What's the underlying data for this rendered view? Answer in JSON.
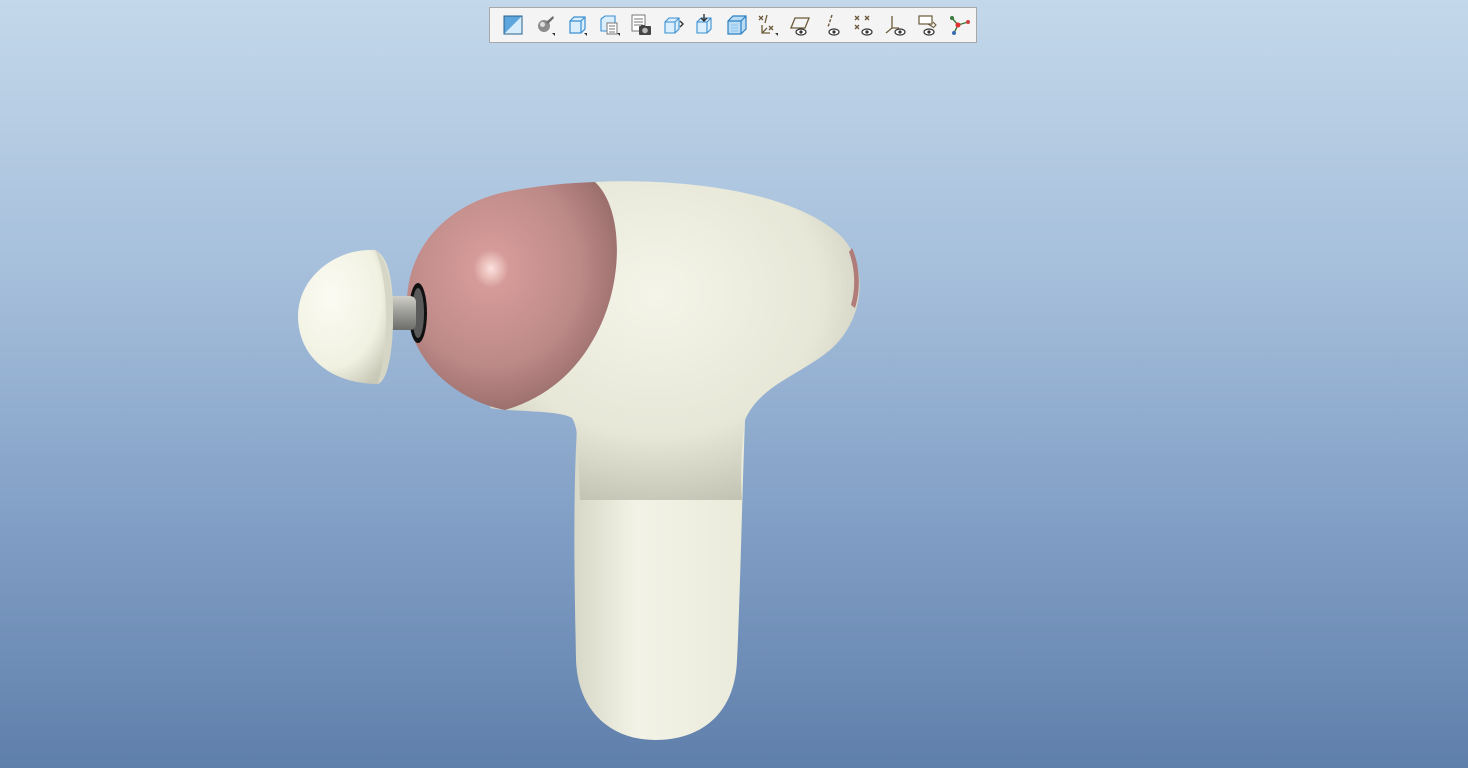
{
  "viewport": {
    "background_top": "#c3d8ea",
    "background_bottom": "#5f7fab"
  },
  "toolbar": {
    "buttons": [
      {
        "icon": "refit-view-icon"
      },
      {
        "icon": "display-style-icon"
      },
      {
        "icon": "standard-orientation-icon"
      },
      {
        "icon": "saved-views-icon"
      },
      {
        "icon": "view-manager-icon"
      },
      {
        "icon": "zoom-in-icon"
      },
      {
        "icon": "zoom-out-icon"
      },
      {
        "icon": "repaint-icon"
      },
      {
        "icon": "datum-display-filters-icon"
      },
      {
        "icon": "plane-display-icon"
      },
      {
        "icon": "axis-display-icon"
      },
      {
        "icon": "point-display-icon"
      },
      {
        "icon": "csys-display-icon"
      },
      {
        "icon": "annotation-display-icon"
      },
      {
        "icon": "spin-center-icon"
      }
    ]
  },
  "model": {
    "body_color": "#f0f0e2",
    "accent_color": "#c48a88",
    "head_color": "#f6f6ea"
  }
}
